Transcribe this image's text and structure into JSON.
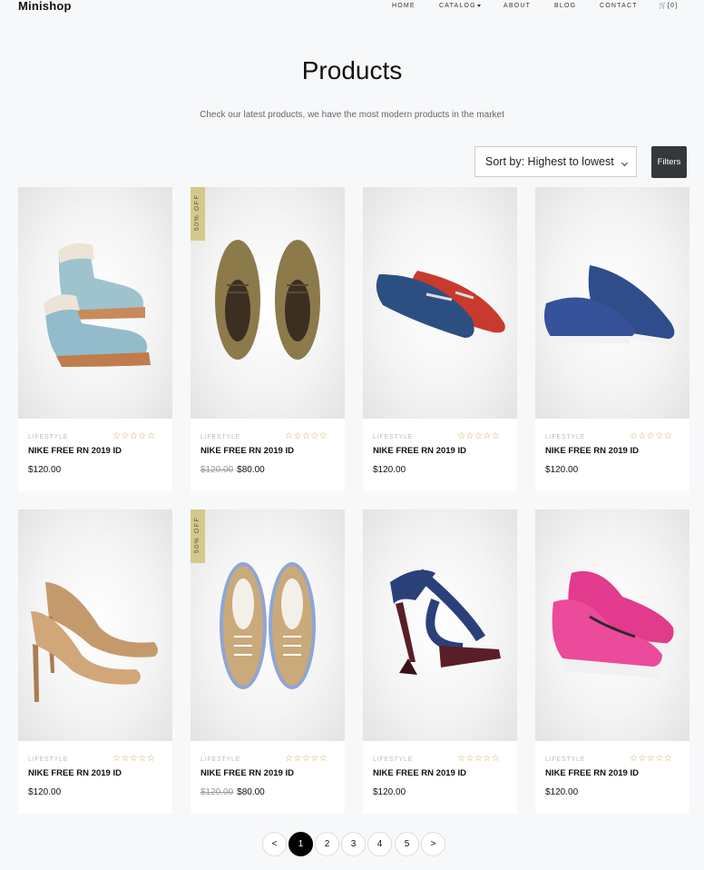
{
  "brand": "Minishop",
  "nav": {
    "home": "HOME",
    "catalog": "CATALOG",
    "about": "ABOUT",
    "blog": "BLOG",
    "contact": "CONTACT",
    "cart": "[0]"
  },
  "header": {
    "title": "Products",
    "subtitle": "Check our latest products, we have the most modern products in the market"
  },
  "toolbar": {
    "sort_label": "Sort by: Highest to lowest",
    "filters_label": "Filters"
  },
  "products": [
    {
      "category": "LIFESTYLE",
      "name": "NIKE FREE RN 2019 ID",
      "price": "$120.00",
      "old_price": "",
      "badge": "",
      "rating": 0,
      "image": "blue-winter-boots"
    },
    {
      "category": "LIFESTYLE",
      "name": "NIKE FREE RN 2019 ID",
      "price": "$80.00",
      "old_price": "$120.00",
      "badge": "50% OFF",
      "rating": 0,
      "image": "brown-suede-shoes"
    },
    {
      "category": "LIFESTYLE",
      "name": "NIKE FREE RN 2019 ID",
      "price": "$120.00",
      "old_price": "",
      "badge": "",
      "rating": 0,
      "image": "loafers-blue-red"
    },
    {
      "category": "LIFESTYLE",
      "name": "NIKE FREE RN 2019 ID",
      "price": "$120.00",
      "old_price": "",
      "badge": "",
      "rating": 0,
      "image": "navy-canvas-sneakers"
    },
    {
      "category": "LIFESTYLE",
      "name": "NIKE FREE RN 2019 ID",
      "price": "$120.00",
      "old_price": "",
      "badge": "",
      "rating": 0,
      "image": "beige-high-heels"
    },
    {
      "category": "LIFESTYLE",
      "name": "NIKE FREE RN 2019 ID",
      "price": "$80.00",
      "old_price": "$120.00",
      "badge": "50% OFF",
      "rating": 0,
      "image": "tan-canvas-sneakers"
    },
    {
      "category": "LIFESTYLE",
      "name": "NIKE FREE RN 2019 ID",
      "price": "$120.00",
      "old_price": "",
      "badge": "",
      "rating": 0,
      "image": "navy-strappy-heels"
    },
    {
      "category": "LIFESTYLE",
      "name": "NIKE FREE RN 2019 ID",
      "price": "$120.00",
      "old_price": "",
      "badge": "",
      "rating": 0,
      "image": "pink-running-shoes"
    }
  ],
  "stars_text": "☆☆☆☆☆",
  "pagination": {
    "prev": "<",
    "pages": [
      "1",
      "2",
      "3",
      "4",
      "5"
    ],
    "next": ">",
    "active": 1
  },
  "colors": {
    "accent_dark": "#33383d",
    "badge": "#d4c98a",
    "star": "#d0a94f",
    "page_bg": "#f7f8fa"
  }
}
